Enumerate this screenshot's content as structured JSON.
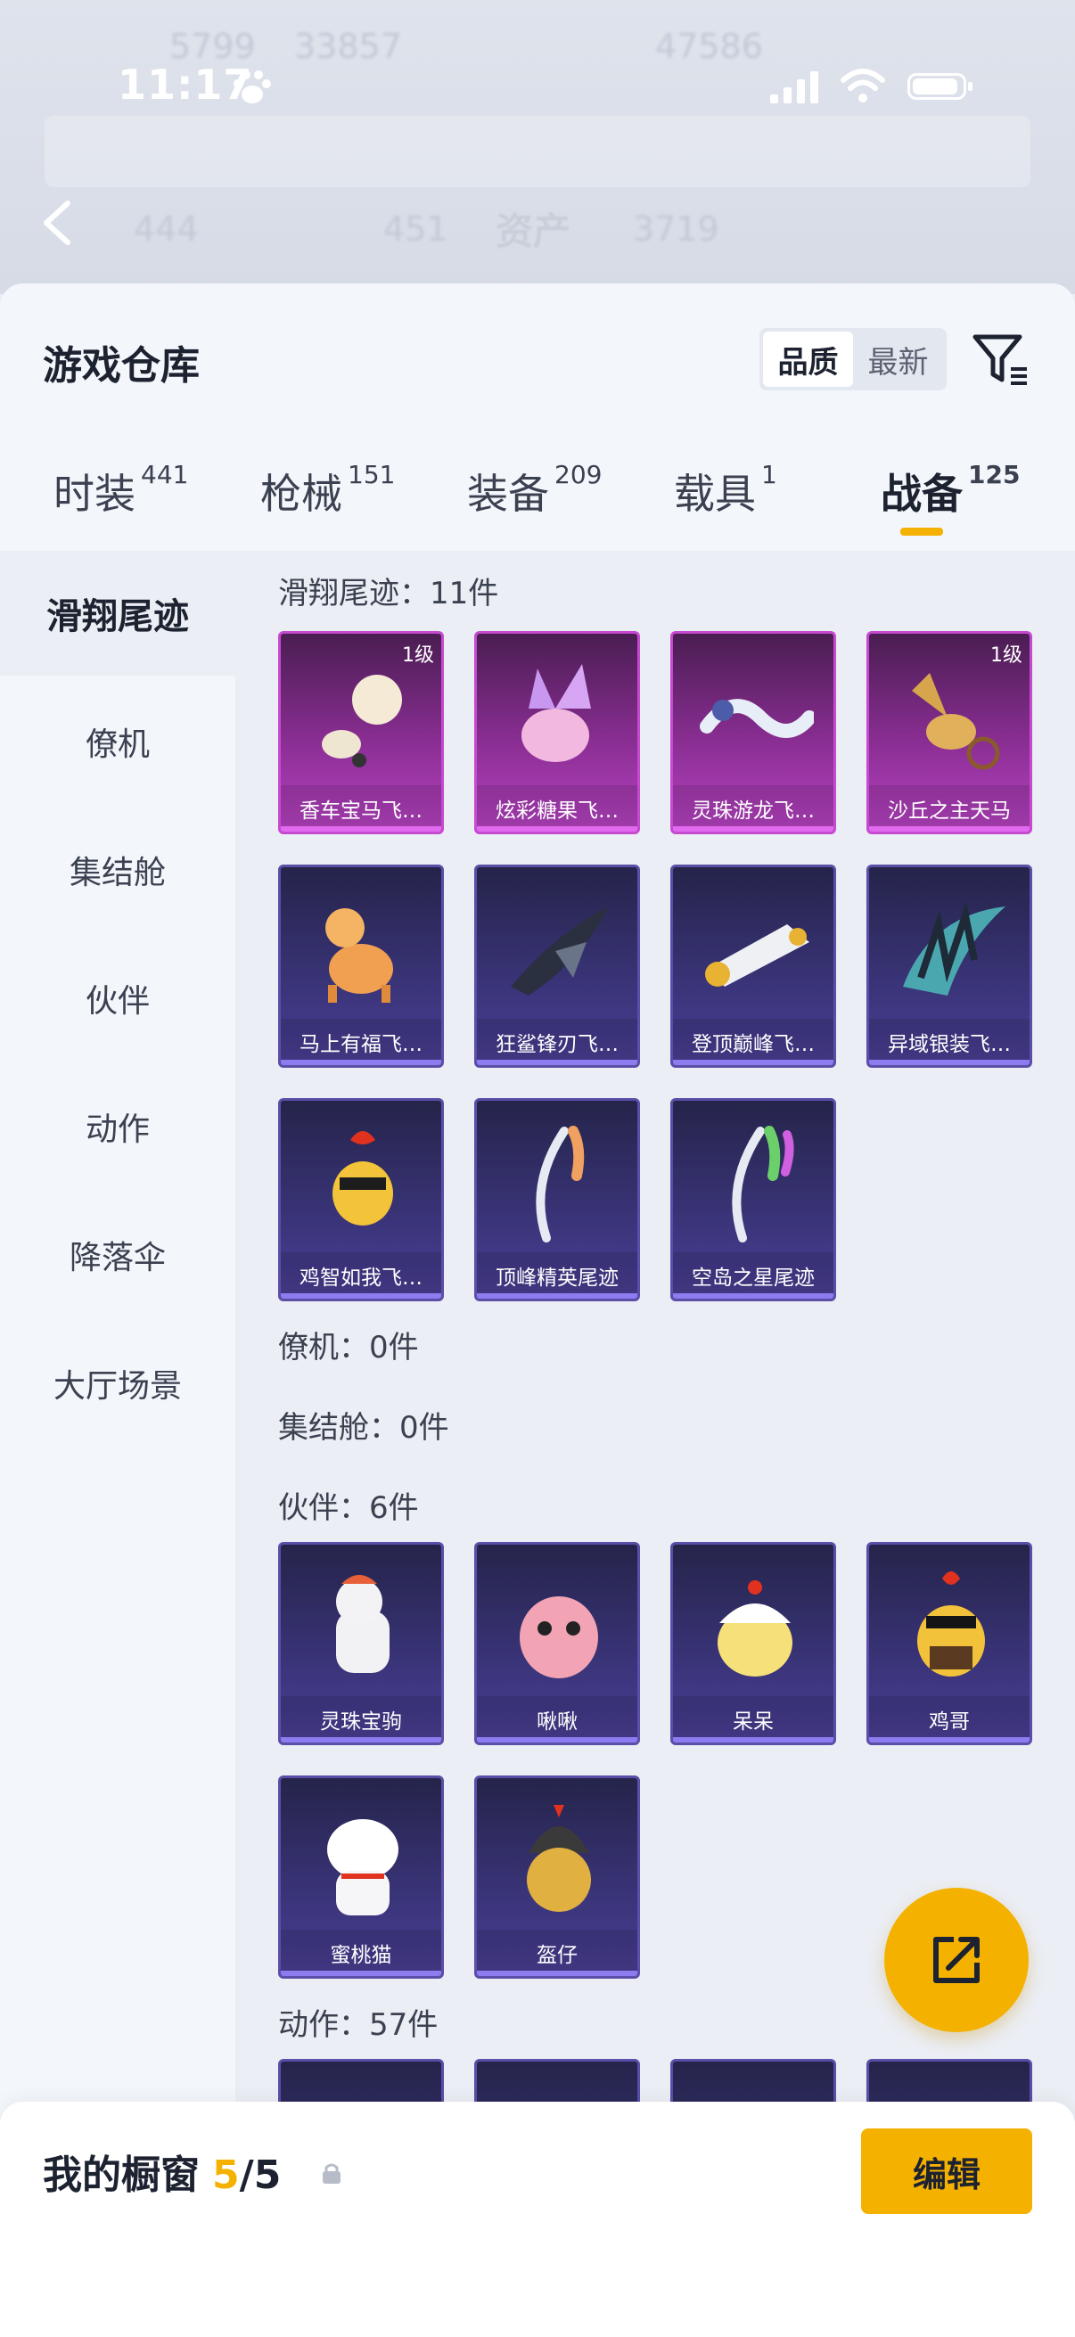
{
  "status_bar": {
    "time": "11:17"
  },
  "background": {
    "title": "资产",
    "ghost_values": [
      "5799",
      "33857",
      "47586",
      "444",
      "451",
      "3719"
    ]
  },
  "sheet": {
    "title": "游戏仓库",
    "sort_options": [
      "品质",
      "最新"
    ],
    "sort_selected": "品质"
  },
  "tabs": [
    {
      "label": "时装",
      "count": "441"
    },
    {
      "label": "枪械",
      "count": "151"
    },
    {
      "label": "装备",
      "count": "209"
    },
    {
      "label": "载具",
      "count": "1"
    },
    {
      "label": "战备",
      "count": "125"
    }
  ],
  "active_tab": "战备",
  "sidenav": [
    "滑翔尾迹",
    "僚机",
    "集结舱",
    "伙伴",
    "动作",
    "降落伞",
    "大厅场景"
  ],
  "sections": {
    "glide": {
      "title": "滑翔尾迹：11件"
    },
    "wingman": {
      "title": "僚机：0件"
    },
    "pod": {
      "title": "集结舱：0件"
    },
    "partner": {
      "title": "伙伴：6件"
    },
    "action": {
      "title": "动作：57件"
    }
  },
  "glide_items": [
    {
      "name": "香车宝马飞…",
      "badge": "1级",
      "rarity": "legend"
    },
    {
      "name": "炫彩糖果飞…",
      "badge": "",
      "rarity": "legend"
    },
    {
      "name": "灵珠游龙飞…",
      "badge": "",
      "rarity": "legend"
    },
    {
      "name": "沙丘之主天马",
      "badge": "1级",
      "rarity": "legend"
    },
    {
      "name": "马上有福飞…",
      "badge": "",
      "rarity": "epic"
    },
    {
      "name": "狂鲨锋刃飞…",
      "badge": "",
      "rarity": "epic"
    },
    {
      "name": "登顶巅峰飞…",
      "badge": "",
      "rarity": "epic"
    },
    {
      "name": "异域银装飞…",
      "badge": "",
      "rarity": "epic"
    },
    {
      "name": "鸡智如我飞…",
      "badge": "",
      "rarity": "epic"
    },
    {
      "name": "顶峰精英尾迹",
      "badge": "",
      "rarity": "epic"
    },
    {
      "name": "空岛之星尾迹",
      "badge": "",
      "rarity": "epic"
    }
  ],
  "partner_items": [
    {
      "name": "灵珠宝驹"
    },
    {
      "name": "啾啾"
    },
    {
      "name": "呆呆"
    },
    {
      "name": "鸡哥"
    },
    {
      "name": "蜜桃猫"
    },
    {
      "name": "盔仔"
    }
  ],
  "bottom": {
    "label": "我的橱窗",
    "count": "5",
    "total": "/5",
    "edit_label": "编辑"
  },
  "colors": {
    "accent": "#f5b100",
    "legend": "#b843c4",
    "epic": "#4a3f95"
  }
}
